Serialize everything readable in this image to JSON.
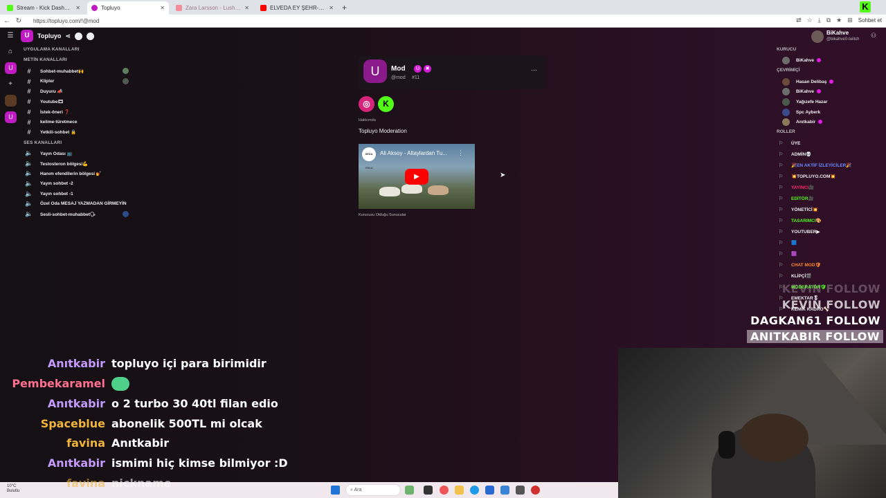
{
  "browser": {
    "tabs": [
      {
        "label": "Stream - Kick Dashboard",
        "color": "#53fc18",
        "active": false
      },
      {
        "label": "Topluyo",
        "color": "#c01ac3",
        "active": true
      },
      {
        "label": "Zara Larsson - Lush Life (Official V...",
        "color": "#f28b9b",
        "active": false
      },
      {
        "label": "ELVEDA EY ŞEHR-İ RAMAZAN | M...",
        "color": "#ff0000",
        "active": false
      }
    ],
    "url": "https://topluyo.com/!@mod",
    "chat_button": "Sohbet et"
  },
  "server": {
    "name": "Topluyo",
    "sections": {
      "app_channels": "UYGULAMA KANALLARI",
      "text_channels": "METİN KANALLARI",
      "voice_channels": "SES KANALLARI"
    },
    "text_channels": [
      {
        "label": "Sohbet-muhabbet🙌",
        "icon": "hash-icon"
      },
      {
        "label": "Klipler",
        "icon": "hash-icon"
      },
      {
        "label": "Duyuru 📣",
        "icon": "hash-icon"
      },
      {
        "label": "Youtube🎞",
        "icon": "hash-icon"
      },
      {
        "label": "İstek-öneri ❓",
        "icon": "hash-icon"
      },
      {
        "label": "kelime-türetmece",
        "icon": "hash-icon"
      },
      {
        "label": "Yetkili-sohbet 🔒",
        "icon": "hash-icon"
      }
    ],
    "voice_channels": [
      {
        "label": "Yayın Odası 📺",
        "icon": "speaker-icon"
      },
      {
        "label": "Testosteron bölgesi💪",
        "icon": "speaker-icon"
      },
      {
        "label": "Hanım efendilerin bölgesi 💅",
        "icon": "speaker-icon"
      },
      {
        "label": "Yayın sohbet -2",
        "icon": "speaker-icon"
      },
      {
        "label": "Yayın sohbet -1",
        "icon": "speaker-icon"
      },
      {
        "label": "Özel Oda MESAJ YAZMADAN GİRMEYİN",
        "icon": "speaker-icon"
      },
      {
        "label": "Sesli-sohbet-muhabbet🗣",
        "icon": "speaker-icon"
      }
    ]
  },
  "profile": {
    "name": "Mod",
    "handle": "@mod",
    "number": "#11",
    "about_label": "Hakkımda",
    "about_text": "Topluyo Moderation",
    "video_title": "Ali Aksoy - Altaylardan Tu...",
    "video_channel": "SEDA YOLU",
    "servers_caption": "Kurucusu Olduğu Sunucular"
  },
  "user": {
    "name": "BiKahve",
    "handle": "@bikahve0-twitch"
  },
  "members": {
    "founder_title": "KURUCU",
    "founder": "BiKahve",
    "online_title": "ÇEVRİMİÇİ",
    "online": [
      "Hasan Delibaş",
      "BiKahve",
      "Yağızefe Hazar",
      "Spc Ayberk",
      "Anıtkabir"
    ],
    "roles_title": "ROLLER",
    "roles": [
      {
        "label": "ÜYE",
        "color": "#eeeeee"
      },
      {
        "label": "ADMİN💀",
        "color": "#eeeeee"
      },
      {
        "label": "🎉EN AKTİF İZLEYİCİLER🎉",
        "color": "#6a8cff"
      },
      {
        "label": "💥TOPLUYO.COM💥",
        "color": "#eeeeee"
      },
      {
        "label": "YAYINCI🎥",
        "color": "#ff2e6a"
      },
      {
        "label": "EDİTÖR🎥",
        "color": "#53fc18"
      },
      {
        "label": "YÖNETİCİ💥",
        "color": "#eeeeee"
      },
      {
        "label": "TASARIMCI🎨",
        "color": "#53fc18"
      },
      {
        "label": "YOUTUBER▶",
        "color": "#eeeeee"
      },
      {
        "label": "🟦",
        "color": "#5aa0ff"
      },
      {
        "label": "🟪",
        "color": "#d21bd2"
      },
      {
        "label": "CHAT MOD🛡",
        "color": "#ff8a2e"
      },
      {
        "label": "KLİPÇİ🎬",
        "color": "#eeeeee"
      },
      {
        "label": "MODERATÖR🛡",
        "color": "#53fc18"
      },
      {
        "label": "EMEKTAR🎖",
        "color": "#eeeeee"
      },
      {
        "label": "KEMİK KADRO🦴",
        "color": "#eeeeee"
      }
    ]
  },
  "follow_alerts": [
    {
      "text": "KEVIN  FOLLOW",
      "style": "dim1"
    },
    {
      "text": "KEVIN  FOLLOW",
      "style": "dim2"
    },
    {
      "text": "DAGKAN61  FOLLOW",
      "style": "strong"
    },
    {
      "text": "ANITKABIR  FOLLOW",
      "style": "boxed"
    }
  ],
  "chat": [
    {
      "user": "Anıtkabir",
      "color": "#c59aff",
      "msg": "topluyo içi para birimidir"
    },
    {
      "user": "Pembekaramel",
      "color": "#ff6f8f",
      "msg": "",
      "emote": "frog-emote"
    },
    {
      "user": "Anıtkabir",
      "color": "#c59aff",
      "msg": "o 2 turbo 30 40tl filan edio"
    },
    {
      "user": "Spaceblue",
      "color": "#f2b53c",
      "msg": "abonelik 500TL mi olcak"
    },
    {
      "user": "favina",
      "color": "#f2b53c",
      "msg": "Anıtkabir"
    },
    {
      "user": "Anıtkabir",
      "color": "#c59aff",
      "msg": "ismimi hiç kimse bilmiyor :D"
    },
    {
      "user": "favina",
      "color": "#f2b53c",
      "msg": "nickname"
    }
  ],
  "taskbar": {
    "temp": "10°C",
    "weather": "Bulutlu",
    "search": "Ara"
  }
}
